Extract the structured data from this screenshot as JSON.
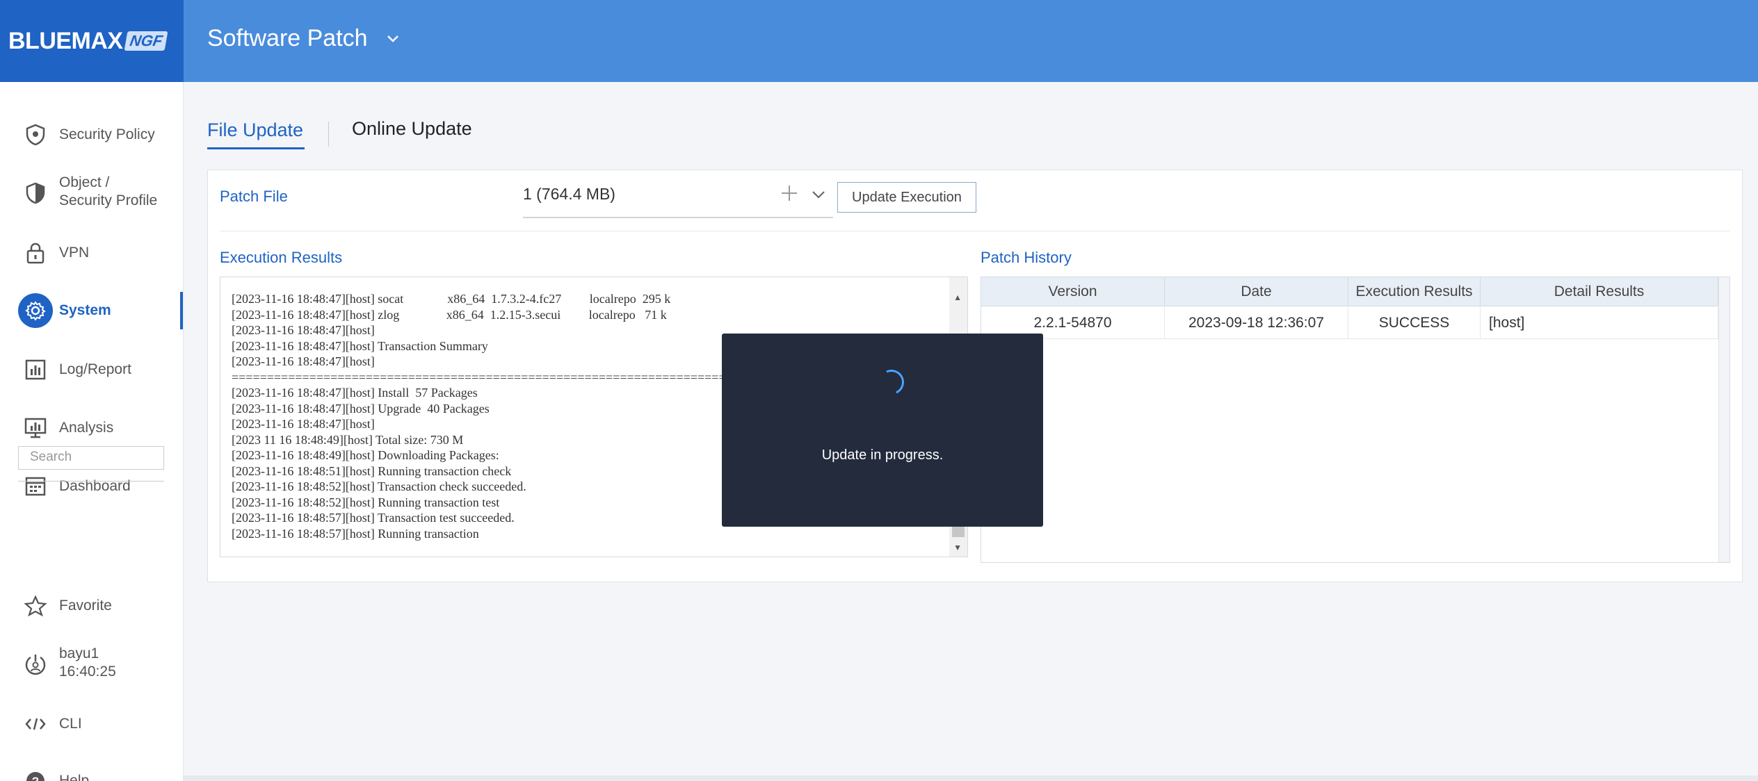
{
  "brand": {
    "name": "BLUEMAX",
    "suffix": "NGF"
  },
  "header": {
    "title": "Software Patch"
  },
  "sidebar": {
    "items": [
      {
        "label": "Security Policy",
        "icon": "shield-icon"
      },
      {
        "label": "Object /",
        "label2": "Security Profile",
        "icon": "shield-half-icon"
      },
      {
        "label": "VPN",
        "icon": "lock-icon"
      },
      {
        "label": "System",
        "icon": "gear-icon",
        "active": true
      },
      {
        "label": "Log/Report",
        "icon": "bar-chart-icon"
      },
      {
        "label": "Analysis",
        "icon": "monitor-chart-icon"
      },
      {
        "label": "Dashboard",
        "icon": "dashboard-icon"
      }
    ],
    "search_placeholder": "Search",
    "bottom": [
      {
        "label": "Favorite",
        "icon": "star-icon"
      },
      {
        "label": "bayu1",
        "label2": "16:40:25",
        "icon": "user-power-icon"
      },
      {
        "label": "CLI",
        "icon": "code-icon"
      },
      {
        "label": "Help",
        "icon": "help-icon"
      }
    ]
  },
  "tabs": {
    "file_update": "File Update",
    "online_update": "Online Update"
  },
  "patch": {
    "label": "Patch File",
    "value": "1 (764.4 MB)",
    "execute_button": "Update Execution"
  },
  "execution": {
    "title": "Execution Results",
    "log": [
      "[2023-11-16 18:48:47][host] socat              x86_64  1.7.3.2-4.fc27         localrepo  295 k",
      "[2023-11-16 18:48:47][host] zlog               x86_64  1.2.15-3.secui         localrepo   71 k",
      "[2023-11-16 18:48:47][host]",
      "[2023-11-16 18:48:47][host] Transaction Summary",
      "[2023-11-16 18:48:47][host]",
      "============================================================================================",
      "[2023-11-16 18:48:47][host] Install  57 Packages",
      "[2023-11-16 18:48:47][host] Upgrade  40 Packages",
      "[2023-11-16 18:48:47][host]",
      "[2023 11 16 18:48:49][host] Total size: 730 M",
      "[2023-11-16 18:48:49][host] Downloading Packages:",
      "[2023-11-16 18:48:51][host] Running transaction check",
      "[2023-11-16 18:48:52][host] Transaction check succeeded.",
      "[2023-11-16 18:48:52][host] Running transaction test",
      "[2023-11-16 18:48:57][host] Transaction test succeeded.",
      "[2023-11-16 18:48:57][host] Running transaction"
    ]
  },
  "history": {
    "title": "Patch History",
    "columns": [
      "Version",
      "Date",
      "Execution Results",
      "Detail Results"
    ],
    "rows": [
      [
        "2.2.1-54870",
        "2023-09-18 12:36:07",
        "SUCCESS",
        "[host]"
      ]
    ]
  },
  "modal": {
    "message": "Update in progress."
  }
}
